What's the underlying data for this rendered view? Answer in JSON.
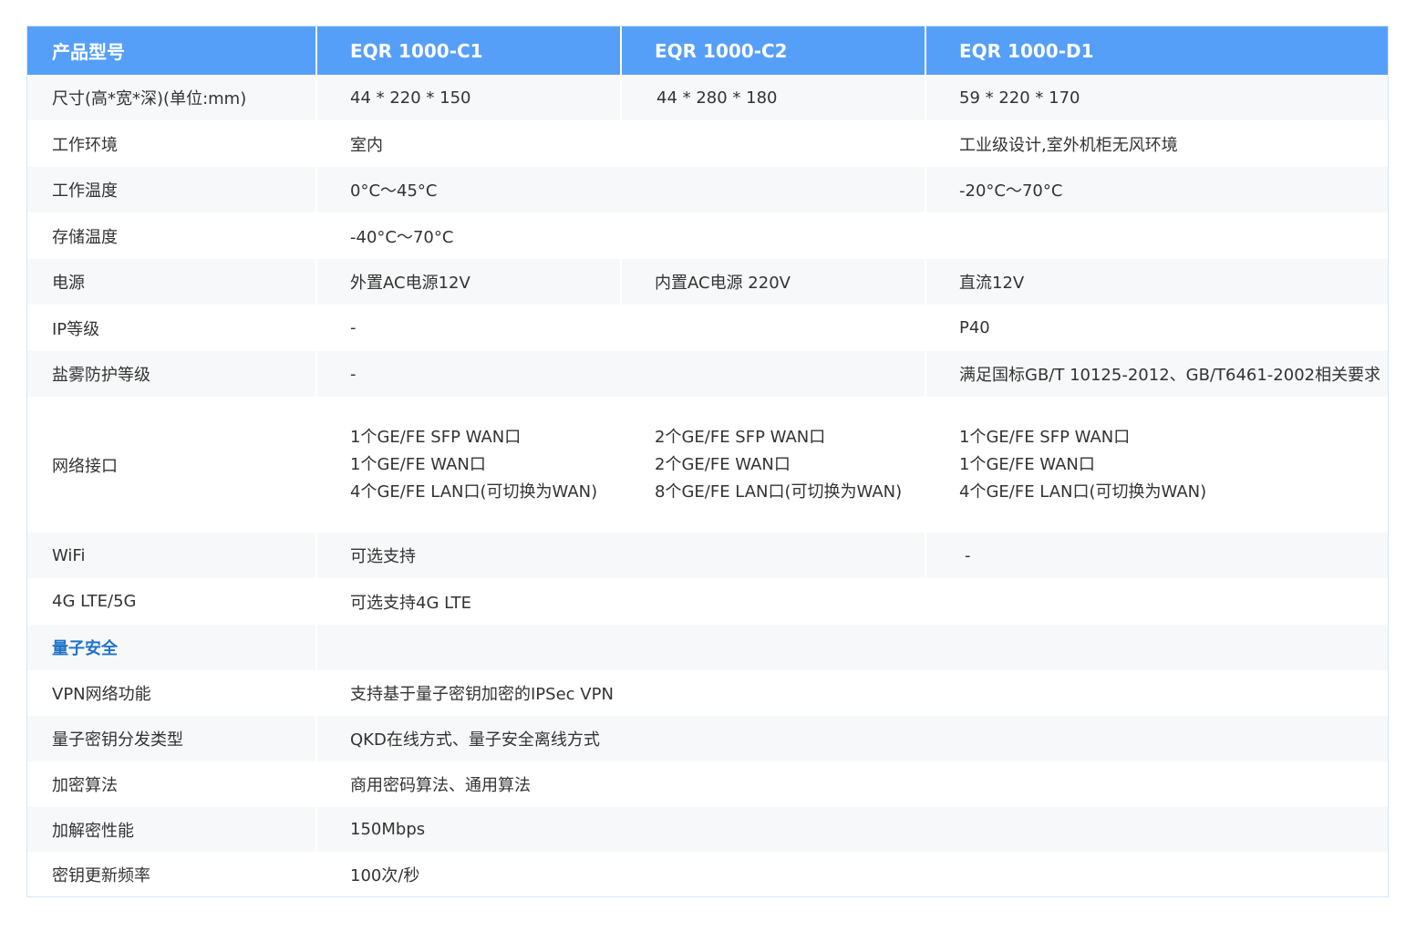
{
  "header": {
    "col0": "产品型号",
    "col1": "EQR 1000-C1",
    "col2": "EQR 1000-C2",
    "col3": "EQR 1000-D1"
  },
  "rows": {
    "dimensions": {
      "label": "尺寸(高*宽*深)(单位:mm)",
      "c1": "44 * 220 * 150",
      "c2": "44 * 280 * 180",
      "d1": "59 * 220 * 170"
    },
    "environment": {
      "label": "工作环境",
      "c1c2": "室内",
      "d1": "工业级设计,室外机柜无风环境"
    },
    "work_temp": {
      "label": "工作温度",
      "c1c2": "0°C～45°C",
      "d1": "-20°C～70°C"
    },
    "storage_temp": {
      "label": "存储温度",
      "all": "-40°C～70°C"
    },
    "power": {
      "label": "电源",
      "c1": "外置AC电源12V",
      "c2": "内置AC电源 220V",
      "d1": "直流12V"
    },
    "ip_level": {
      "label": "IP等级",
      "c1c2": "-",
      "d1": "P40"
    },
    "salt_spray": {
      "label": "盐雾防护等级",
      "c1c2": "-",
      "d1": "满足国标GB/T 10125-2012、GB/T6461-2002相关要求"
    },
    "network": {
      "label": "网络接口",
      "c1": [
        "1个GE/FE SFP WAN口",
        "1个GE/FE WAN口",
        "4个GE/FE LAN口(可切换为WAN)"
      ],
      "c2": [
        "2个GE/FE SFP WAN口",
        "2个GE/FE WAN口",
        "8个GE/FE LAN口(可切换为WAN)"
      ],
      "d1": [
        "1个GE/FE SFP WAN口",
        "1个GE/FE WAN口",
        "4个GE/FE LAN口(可切换为WAN)"
      ]
    },
    "wifi": {
      "label": "WiFi",
      "c1c2": "可选支持",
      "d1": "-"
    },
    "lte": {
      "label": "4G LTE/5G",
      "all": "可选支持4G LTE"
    },
    "quantum_section": {
      "label": "量子安全"
    },
    "vpn": {
      "label": "VPN网络功能",
      "all": "支持基于量子密钥加密的IPSec VPN"
    },
    "qkd_type": {
      "label": "量子密钥分发类型",
      "all": "QKD在线方式、量子安全离线方式"
    },
    "encryption": {
      "label": "加密算法",
      "all": "商用密码算法、通用算法"
    },
    "performance": {
      "label": "加解密性能",
      "all": "150Mbps"
    },
    "key_rate": {
      "label": "密钥更新频率",
      "all": "100次/秒"
    }
  },
  "colors": {
    "header_bg": "#559ff8",
    "row_alt_bg": "#f7f8fa",
    "section_text": "#1f73c9",
    "border": "#d6e6f7"
  }
}
